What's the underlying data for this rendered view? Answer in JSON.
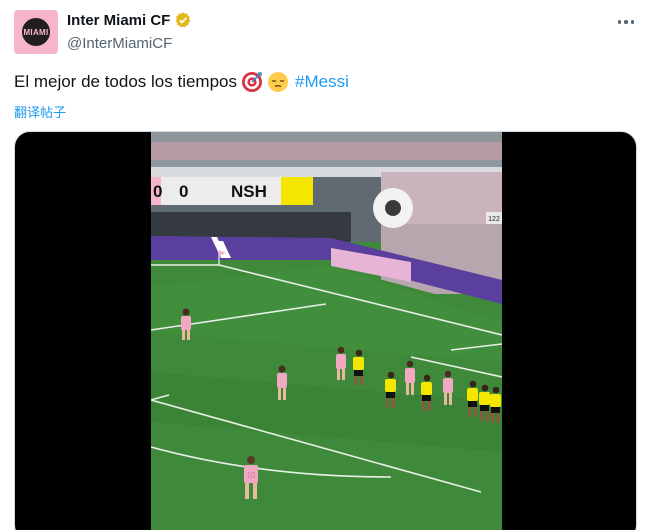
{
  "account": {
    "display_name": "Inter Miami CF",
    "handle": "@InterMiamiCF",
    "avatar_text": "MIAMI"
  },
  "tweet": {
    "text": "El mejor de todos los tiempos",
    "hashtag": "#Messi",
    "emojis": [
      "target-emoji",
      "pensive-face-emoji"
    ],
    "translate_label": "翻译帖子"
  },
  "video": {
    "scoreboard": {
      "home_score": "0",
      "away_score": "0",
      "away_team": "NSH",
      "away_color": "#f5e600"
    },
    "board_logo_text": "122",
    "players": [
      {
        "team": "pink",
        "number": ""
      },
      {
        "team": "pink",
        "number": ""
      },
      {
        "team": "pink",
        "number": "10"
      },
      {
        "team": "pink",
        "number": ""
      },
      {
        "team": "pink",
        "number": ""
      },
      {
        "team": "pink",
        "number": ""
      },
      {
        "team": "yellow",
        "number": ""
      },
      {
        "team": "yellow",
        "number": ""
      },
      {
        "team": "yellow",
        "number": ""
      },
      {
        "team": "yellow",
        "number": ""
      },
      {
        "team": "yellow",
        "number": ""
      },
      {
        "team": "yellow",
        "number": ""
      }
    ]
  },
  "colors": {
    "accent": "#1d9bf0",
    "inter_pink": "#f7b5cd",
    "pitch_green": "#3e8a3a",
    "nashville_yellow": "#f5e600"
  }
}
